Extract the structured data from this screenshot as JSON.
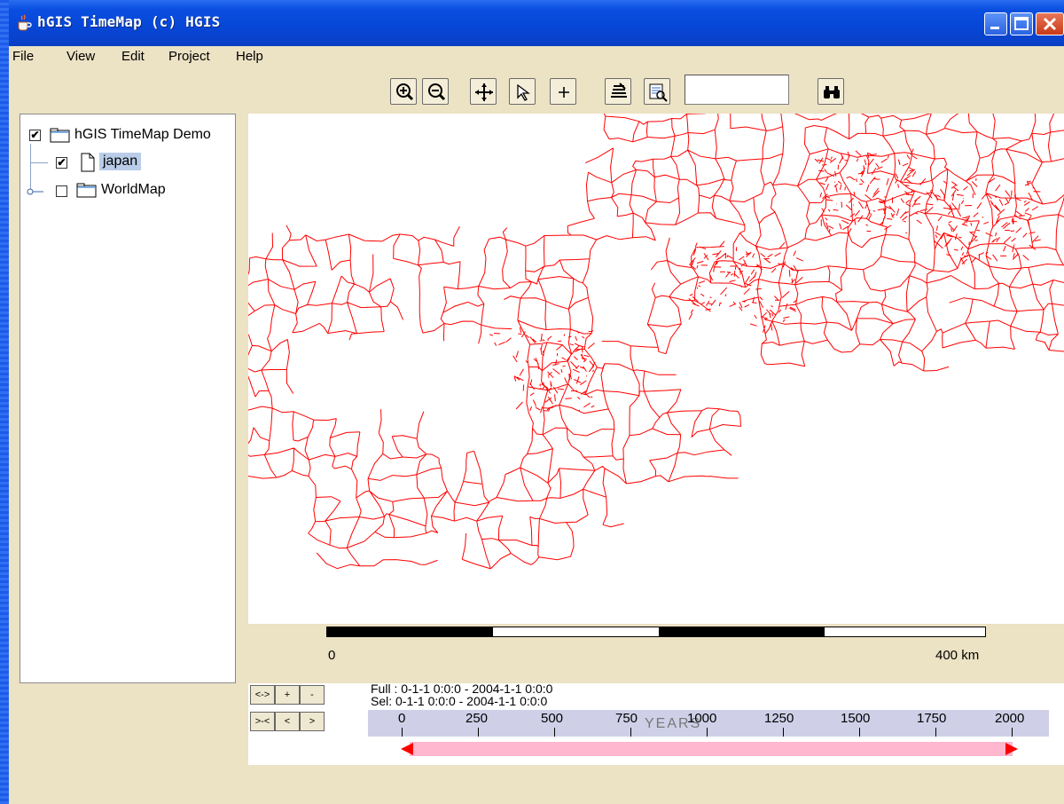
{
  "window": {
    "title": "hGIS TimeMap (c) HGIS"
  },
  "menu": [
    "File",
    "View",
    "Edit",
    "Project",
    "Help"
  ],
  "toolbar": {
    "buttons": [
      "zoom-in-icon",
      "zoom-out-icon",
      "pan-icon",
      "select-pointer-icon",
      "plus-icon",
      "layers-icon",
      "zoom-extent-icon",
      "binoculars-icon"
    ],
    "search_value": ""
  },
  "tree": {
    "root": {
      "label": "hGIS TimeMap Demo",
      "checked": true
    },
    "children": [
      {
        "label": "japan",
        "checked": true,
        "selected": true
      },
      {
        "label": "WorldMap",
        "checked": false
      }
    ]
  },
  "map": {
    "stroke_color": "#ff0000",
    "background": "#ffffff"
  },
  "scale": {
    "start": "0",
    "end": "400 km"
  },
  "time": {
    "controls": [
      "<->",
      "+",
      "-",
      ">-<",
      "<",
      ">"
    ],
    "full": "Full : 0-1-1 0:0:0 - 2004-1-1 0:0:0",
    "sel": "Sel: 0-1-1 0:0:0 - 2004-1-1 0:0:0",
    "axis_label": "YEARS",
    "ticks": [
      "0",
      "250",
      "500",
      "750",
      "1000",
      "1250",
      "1500",
      "1750",
      "2000"
    ],
    "range_color": "#ffb6cf",
    "arrow_color": "#ff0000"
  }
}
